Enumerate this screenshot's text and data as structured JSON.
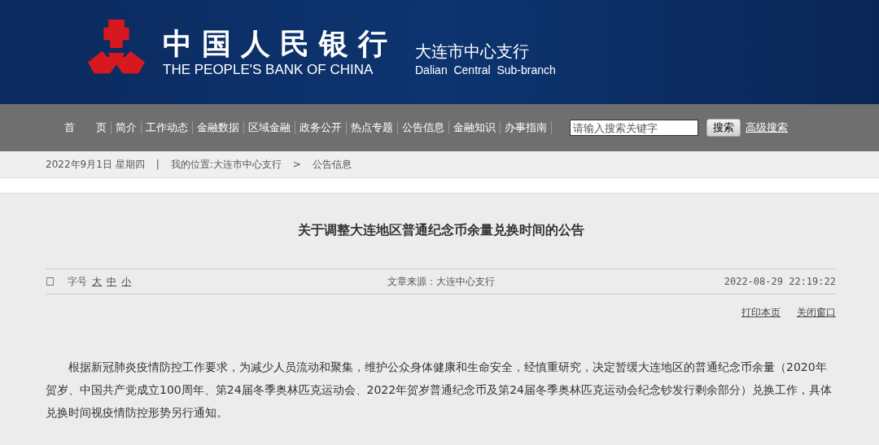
{
  "header": {
    "logo_cn": "中国人民银行",
    "logo_en": "THE PEOPLE'S BANK OF CHINA",
    "branch_cn": "大连市中心支行",
    "branch_en": "Dalian  Central  Sub-branch"
  },
  "nav": {
    "items": [
      {
        "label": "首　　页"
      },
      {
        "label": "简介"
      },
      {
        "label": "工作动态"
      },
      {
        "label": "金融数据"
      },
      {
        "label": "区域金融"
      },
      {
        "label": "政务公开"
      },
      {
        "label": "热点专题"
      },
      {
        "label": "公告信息"
      },
      {
        "label": "金融知识"
      },
      {
        "label": "办事指南"
      }
    ],
    "search": {
      "placeholder": "请输入搜索关键字",
      "button": "搜索",
      "advanced": "高级搜索"
    }
  },
  "breadcrumb": {
    "date": "2022年9月1日  星期四",
    "separator": "|",
    "location": "我的位置:大连市中心支行",
    "arrow": ">",
    "current": "公告信息"
  },
  "article": {
    "title": "关于调整大连地区普通纪念币余量兑换时间的公告",
    "box": "□",
    "font_label": "字号",
    "font_sizes": [
      "大",
      "中",
      "小"
    ],
    "source": "文章来源：大连中心支行",
    "datetime": "2022-08-29 22:19:22",
    "actions": [
      "打印本页",
      "关闭窗口"
    ],
    "paragraph": "根据新冠肺炎疫情防控工作要求，为减少人员流动和聚集，维护公众身体健康和生命安全，经慎重研究，决定暂缓大连地区的普通纪念币余量（2020年贺岁、中国共产党成立100周年、第24届冬季奥林匹克运动会、2022年贺岁普通纪念币及第24届冬季奥林匹克运动会纪念钞发行剩余部分）兑换工作，具体兑换时间视疫情防控形势另行通知。"
  }
}
